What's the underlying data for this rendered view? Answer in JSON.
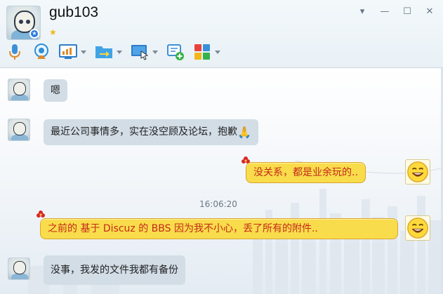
{
  "contact": {
    "name": "gub103",
    "level": "★"
  },
  "window_controls": {
    "options": "▾",
    "minimize": "—",
    "maximize": "☐",
    "close": "✕"
  },
  "toolbar": {
    "tools": [
      {
        "name": "voice-call",
        "icon": "microphone-icon",
        "has_menu": false
      },
      {
        "name": "video-call",
        "icon": "webcam-icon",
        "has_menu": false
      },
      {
        "name": "remote-assistance",
        "icon": "monitor-chart-icon",
        "has_menu": true
      },
      {
        "name": "send-file",
        "icon": "folder-arrow-icon",
        "has_menu": true
      },
      {
        "name": "screen-share",
        "icon": "screen-cursor-icon",
        "has_menu": true
      },
      {
        "name": "create-discussion",
        "icon": "chat-plus-icon",
        "has_menu": false
      },
      {
        "name": "app-center",
        "icon": "app-grid-icon",
        "has_menu": true
      }
    ]
  },
  "messages": [
    {
      "side": "left",
      "text": "嗯"
    },
    {
      "side": "left",
      "text": "最近公司事情多，实在没空顾及论坛，抱歉",
      "emoji": "🙏"
    },
    {
      "side": "right",
      "text": "没关系，都是业余玩的.."
    },
    {
      "type": "time",
      "text": "16:06:20"
    },
    {
      "side": "right",
      "text": "之前的 基于 Discuz 的 BBS 因为我不小心，丢了所有的附件.."
    },
    {
      "side": "left",
      "text": "没事，我发的文件我都有备份"
    }
  ],
  "colors": {
    "incoming_bubble": "#d2dde6",
    "outgoing_bubble": "#f9dc4b",
    "outgoing_text": "#c42a1a"
  }
}
